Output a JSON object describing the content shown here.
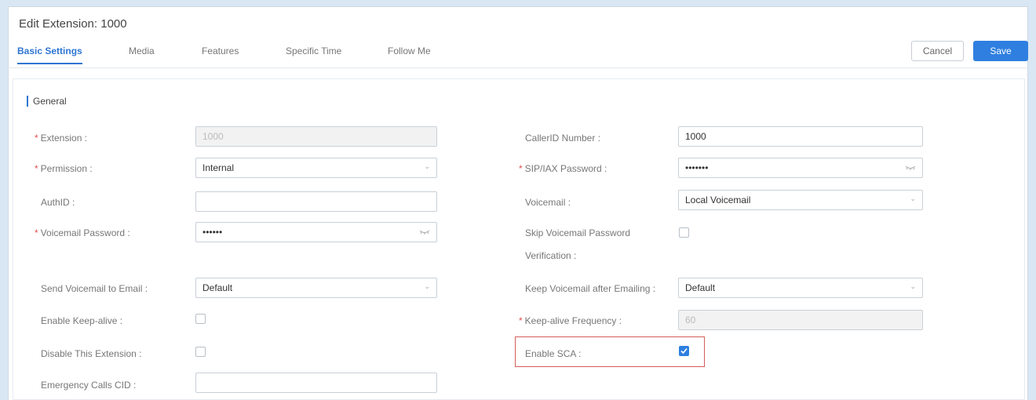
{
  "page": {
    "title": "Edit Extension: 1000",
    "tabs": [
      "Basic Settings",
      "Media",
      "Features",
      "Specific Time",
      "Follow Me"
    ],
    "active_tab": "Basic Settings",
    "cancel_label": "Cancel",
    "save_label": "Save"
  },
  "section": {
    "title": "General"
  },
  "fields": {
    "extension": {
      "label": "Extension :",
      "value": "1000",
      "required": "*"
    },
    "callerid_number": {
      "label": "CallerID Number :",
      "value": "1000"
    },
    "permission": {
      "label": "Permission :",
      "value": "Internal",
      "required": "*"
    },
    "sip_iax_password": {
      "label": "SIP/IAX Password :",
      "value": "•••••••",
      "required": "*"
    },
    "authid": {
      "label": "AuthID :",
      "value": ""
    },
    "voicemail": {
      "label": "Voicemail :",
      "value": "Local Voicemail"
    },
    "voicemail_password": {
      "label": "Voicemail Password :",
      "value": "••••••",
      "required": "*"
    },
    "skip_voicemail_password": {
      "label_line1": "Skip Voicemail Password",
      "label_line2": "Verification :",
      "checked": false
    },
    "send_voicemail_to_email": {
      "label": "Send Voicemail to Email :",
      "value": "Default"
    },
    "keep_voicemail_after_emailing": {
      "label": "Keep Voicemail after Emailing :",
      "value": "Default"
    },
    "enable_keep_alive": {
      "label": "Enable Keep-alive :",
      "checked": false
    },
    "keep_alive_frequency": {
      "label": "Keep-alive Frequency :",
      "value": "60",
      "required": "*"
    },
    "disable_this_extension": {
      "label": "Disable This Extension :",
      "checked": false
    },
    "enable_sca": {
      "label": "Enable SCA :",
      "checked": true
    },
    "emergency_calls_cid": {
      "label": "Emergency Calls CID :",
      "value": ""
    }
  },
  "icons": {
    "dropdown": "chevron-down-icon",
    "password_toggle": "eye-hidden-icon",
    "checkbox_checked": "checkmark-icon"
  },
  "colors": {
    "accent": "#2f76d2",
    "save_button": "#2f7fe0",
    "required": "#e05050",
    "highlight_border": "#d65c5c",
    "background": "#d9e7f4"
  }
}
